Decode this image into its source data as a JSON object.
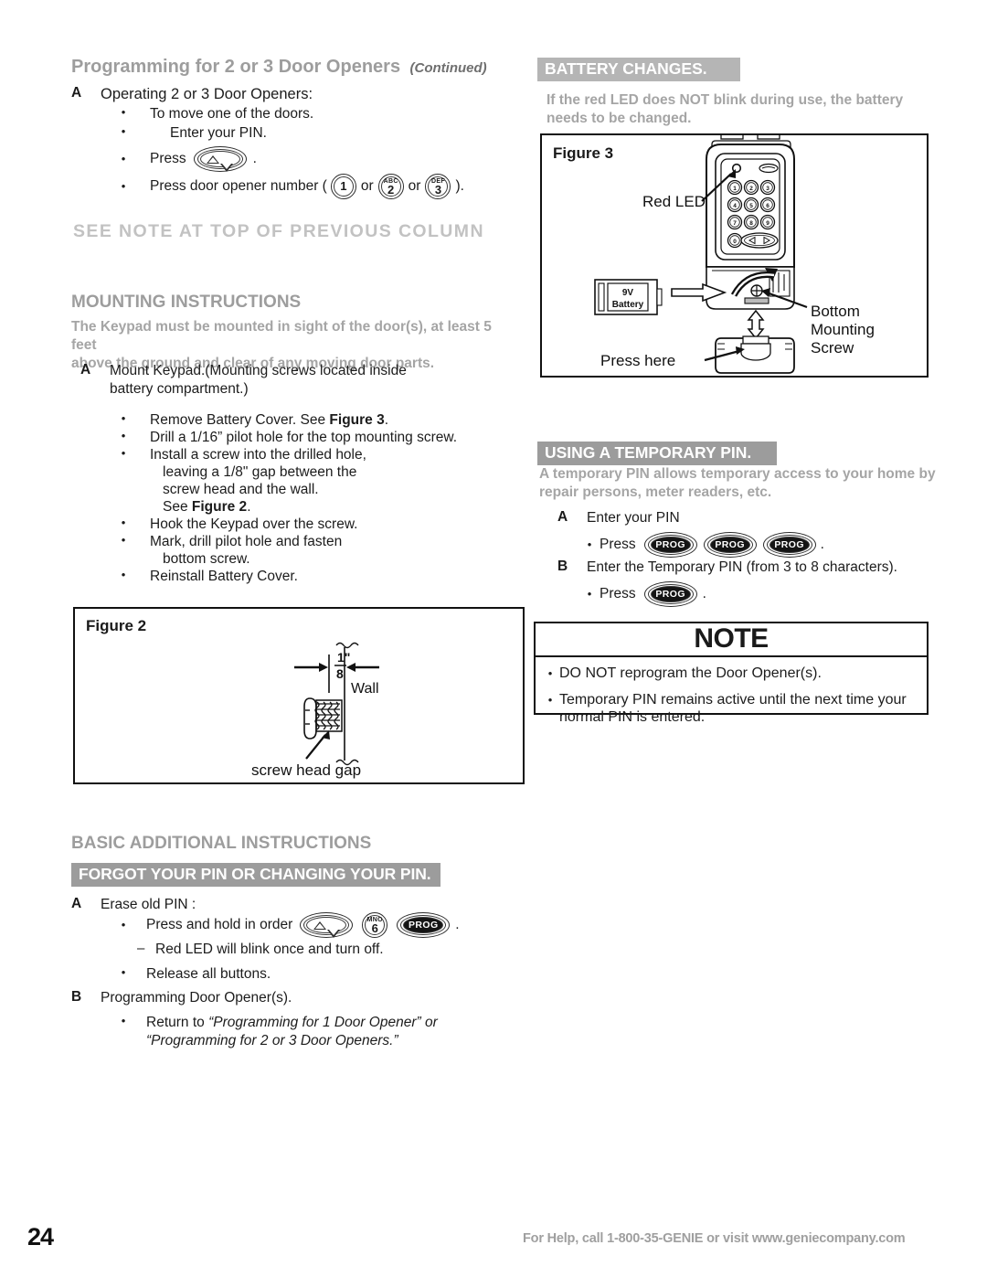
{
  "left_column": {
    "heading": "Programming for 2 or 3 Door Openers",
    "heading_continued": "(Continued)",
    "step_a_letter": "A",
    "step_a_text": "Operating 2 or 3 Door Openers:",
    "bullets": [
      "To move one of the doors.",
      "Enter your PIN."
    ],
    "press_label": "Press",
    "press_period": ".",
    "door_opener_prefix": "Press door opener number (",
    "or_1": "or",
    "or_2": "or",
    "door_opener_suffix": ").",
    "keys": [
      {
        "top": "",
        "num": "1"
      },
      {
        "top": "ABC",
        "num": "2"
      },
      {
        "top": "DEF",
        "num": "3"
      }
    ],
    "see_note_banner": "SEE NOTE AT TOP OF PREVIOUS COLUMN",
    "mounting": {
      "title_cap": "M",
      "title_rest": "OUNTING ",
      "title_cap2": "I",
      "title_rest2": "NSTRUCTIONS",
      "title_full": "MOUNTING INSTRUCTIONS",
      "subtitle_line1": "The Keypad must be mounted in sight of the door(s),  at least 5 feet",
      "subtitle_line2": "above the ground and clear of any moving door parts.",
      "step_a_letter": "A",
      "step_a_line1": "Mount Keypad.(Mounting screws located inside",
      "step_a_line2": "battery compartment.)",
      "bullets": [
        {
          "text": "Remove Battery Cover.  See ",
          "bold_tail": "Figure 3",
          "tail": "."
        },
        {
          "text": "Drill a 1/16” pilot hole for the top mounting screw.",
          "bold_tail": "",
          "tail": ""
        },
        {
          "text": "Install a screw into the drilled hole,",
          "bold_tail": "",
          "tail": ""
        },
        {
          "text": "Hook the Keypad over the screw.",
          "bold_tail": "",
          "tail": ""
        },
        {
          "text": "Mark, drill pilot hole and fasten",
          "bold_tail": "",
          "tail": ""
        },
        {
          "text": "Reinstall Battery Cover.",
          "bold_tail": "",
          "tail": ""
        }
      ],
      "cont_line_1": "leaving a 1/8\" gap between the",
      "cont_line_2": "screw head and the wall.",
      "cont_line_3_prefix": "See ",
      "cont_line_3_bold": "Figure 2",
      "cont_line_3_suffix": ".",
      "cont_line_4": "bottom screw."
    },
    "figure2": {
      "label": "Figure 2",
      "dim_numerator": "1\"",
      "dim_denominator": "8",
      "wall_label": "Wall",
      "gap_label": "screw head gap"
    },
    "basic": {
      "title": "BASIC ADDITIONAL INSTRUCTIONS",
      "banner": "FORGOT YOUR PIN OR CHANGING YOUR PIN.",
      "step_a_letter": "A",
      "step_a_text": "Erase old PIN :",
      "press_hold_label": "Press and hold in order",
      "press_hold_period": ".",
      "key_6_top": "MNO",
      "key_6_num": "6",
      "key_prog": "PROG",
      "dash_item": "Red LED will blink once and turn off.",
      "release_item": "Release all buttons.",
      "step_b_letter": "B",
      "step_b_text": "Programming Door Opener(s).",
      "return_prefix": "Return to ",
      "return_quote1": "“Programming for 1 Door Opener” or",
      "return_quote2": "“Programming for 2 or 3 Door Openers.”"
    }
  },
  "right_column": {
    "battery": {
      "banner": "BATTERY CHANGES.",
      "line1": "If the red LED does NOT blink during use, the battery",
      "line2": "needs to be changed."
    },
    "figure3": {
      "label": "Figure 3",
      "red_led_label": "Red LED",
      "battery_label_line1": "9V",
      "battery_label_line2": "Battery",
      "press_here_label": "Press here",
      "bottom_label_line1": "Bottom",
      "bottom_label_line2": "Mounting",
      "bottom_label_line3": "Screw",
      "keypad_keys": [
        "1",
        "2",
        "3",
        "4",
        "5",
        "6",
        "7",
        "8",
        "9",
        "0"
      ]
    },
    "temp_pin": {
      "banner": "USING A TEMPORARY PIN.",
      "line1": "A temporary PIN allows temporary access to your home by",
      "line2": "repair persons,  meter readers, etc.",
      "step_a_letter": "A",
      "step_a_text": "Enter your PIN",
      "press_label": "Press",
      "press_period": ".",
      "key_prog": "PROG",
      "step_b_letter": "B",
      "step_b_text": "Enter the Temporary PIN (from 3 to 8 characters).",
      "press_label_2": "Press",
      "press_period_2": "."
    },
    "note": {
      "title": "NOTE",
      "items": [
        "DO NOT reprogram the Door Opener(s).",
        "Temporary PIN remains active until  the next time your",
        "normal PIN is entered."
      ]
    }
  },
  "footer": {
    "page_number": "24",
    "help_text": "For Help, call 1-800-35-GENIE or visit www.geniecompany.com"
  },
  "colors": {
    "gray_heading": "#9d9d9d",
    "banner_bg": "#9c9c9c",
    "banner_bg_faded": "#b5b5b5",
    "text": "#1c1c1c",
    "rule": "#111111"
  }
}
